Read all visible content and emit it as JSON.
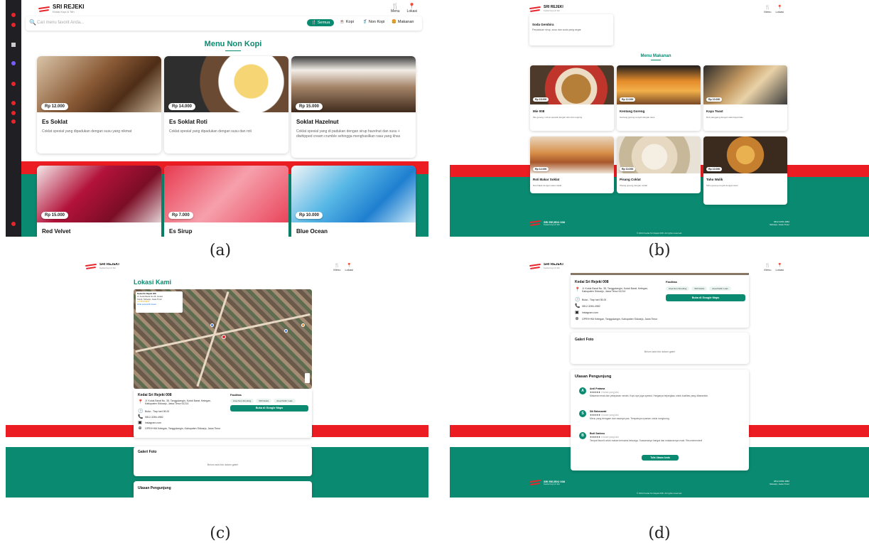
{
  "brand": {
    "name": "SRI REJEKI",
    "tagline": "Kedai Kopi & Teh"
  },
  "nav": {
    "menu_label": "Menu",
    "location_label": "Lokasi"
  },
  "captions": {
    "a": "(a)",
    "b": "(b)",
    "c": "(c)",
    "d": "(d)"
  },
  "panel_a": {
    "search_placeholder": "Cari menu favorit Anda...",
    "filters": [
      {
        "label": "Semua",
        "active": true
      },
      {
        "label": "Kopi",
        "active": false
      },
      {
        "label": "Non Kopi",
        "active": false
      },
      {
        "label": "Makanan",
        "active": false
      }
    ],
    "section_title": "Menu Non Kopi",
    "items": [
      {
        "name": "Es Soklat",
        "price": "Rp 12.000",
        "desc": "Coklat spesial yang dipadukan dengan susu yang nikmat"
      },
      {
        "name": "Es Soklat Roti",
        "price": "Rp 14.000",
        "desc": "Coklat spesial yang dipadukan dengan susu dan roti"
      },
      {
        "name": "Soklat Hazelnut",
        "price": "Rp 15.000",
        "desc": "Coklat spesial yang di padukan dengan sirup hazelnut dan susu + diwhipped cream crumble sehingga menghasilkan rasa yang khas"
      },
      {
        "name": "Red Velvet",
        "price": "Rp 15.000",
        "desc": ""
      },
      {
        "name": "Es Sirup",
        "price": "Rp 7.000",
        "desc": ""
      },
      {
        "name": "Blue Ocean",
        "price": "Rp 10.000",
        "desc": ""
      }
    ]
  },
  "panel_b": {
    "top_card": {
      "name": "Soda Gembira",
      "desc": "Perpaduan sirup, susu dan soda yang segar"
    },
    "section_title": "Menu Makanan",
    "items": [
      {
        "name": "Mie 008",
        "price": "Rp 15.000",
        "desc": "Mie goreng / rebus spesial dengan telur dan topping"
      },
      {
        "name": "Kentang Goreng",
        "price": "Rp 12.000",
        "desc": "Kentang goreng renyah dengan saus"
      },
      {
        "name": "Kaya Toast",
        "price": "Rp 10.000",
        "desc": "Roti panggang dengan selai kaya khas"
      },
      {
        "name": "Roti Bakar Soklat",
        "price": "Rp 12.000",
        "desc": "Roti bakar dengan selai coklat"
      },
      {
        "name": "Pisang Coklat",
        "price": "Rp 10.000",
        "desc": "Pisang goreng dengan coklat"
      },
      {
        "name": "Tahu Walik",
        "price": "Rp 10.000",
        "desc": "Tahu goreng renyah dengan isian"
      }
    ],
    "footer": {
      "title": "SRI REJEKI 008",
      "subtitle": "Kedai Kopi & Teh",
      "right_line1": "0812-3284-4982",
      "right_line2": "Sidoarjo, Jawa Timur",
      "copy": "© 2024 Kedai Sri Rejeki 008. All rights reserved."
    }
  },
  "panel_c": {
    "section_title": "Lokasi Kami",
    "map_popup": {
      "title": "Kedai Sri Rejeki 008",
      "line1": "Jl. Kutuk Barat No.35, Gelam",
      "line2": "Candi, Sidoarjo, Jawa Timur",
      "rating": "4.7 ★★★★★",
      "link": "Lihat peta lebih besar"
    },
    "info_title": "Kedai Sri Rejeki 008",
    "address": "Jl. Kutuk Barat No. 35, Tanggulangin, Kutuk Barat, Ketegan, Kabupaten Sidoarjo, Jawa Timur 61214",
    "hours": "Buka - Tiap hari 08.00",
    "phone": "0812-3284-4982",
    "instagram": "instagram.com",
    "plus_code": "GPR9+HM Ketegan, Tanggulangin, Kabupaten Sidoarjo, Jawa Timur",
    "facilities_title": "Fasilitas",
    "facilities": [
      "Area Non-Smoking",
      "Wifi Gratis",
      "Area Parkir Luas"
    ],
    "maps_button": "Buka di Google Maps",
    "gallery_title": "Galeri Foto",
    "gallery_empty": "Belum ada foto dalam galeri",
    "reviews_title": "Ulasan Pengunjung"
  },
  "panel_d": {
    "info_title": "Kedai Sri Rejeki 008",
    "address": "Jl. Kutuk Barat No. 35, Tanggulangin, Kutuk Barat, Ketegan, Kabupaten Sidoarjo, Jawa Timur 61214",
    "hours": "Buka - Tiap hari 08.00",
    "phone": "0812-3284-4982",
    "instagram": "instagram.com",
    "plus_code": "GPR9+HM Ketegan, Tanggulangin, Kabupaten Sidoarjo, Jawa Timur",
    "facilities_title": "Fasilitas",
    "facilities": [
      "Area Non-Smoking",
      "Wifi Gratis",
      "Area Parkir Luas"
    ],
    "maps_button": "Buka di Google Maps",
    "gallery_title": "Galeri Foto",
    "gallery_empty": "Belum ada foto dalam galeri",
    "reviews_title": "Ulasan Pengunjung",
    "reviews": [
      {
        "initial": "A",
        "name": "Andi Pratama",
        "stars": "★★★★★",
        "date": "2 bulan yang lalu",
        "text": "Makanan enak dan pelayanan ramah. Kopi-nya juga spesial. Harganya terjangkau untuk kualitas yang ditawarkan."
      },
      {
        "initial": "S",
        "name": "Siti Rahmawati",
        "stars": "★★★★★",
        "date": "3 bulan yang lalu",
        "text": "Menu yang beragam dan rasanya pas. Tempatnya nyaman untuk nongkrong."
      },
      {
        "initial": "B",
        "name": "Budi Santoso",
        "stars": "★★★★★",
        "date": "4 bulan yang lalu",
        "text": "Tempat favorit untuk makan bersama keluarga. Suasananya hangat dan makanannya enak. Recommended!"
      }
    ],
    "add_review_button": "Tulis Ulasan Anda",
    "footer": {
      "title": "SRI REJEKI 008",
      "subtitle": "Kedai Kopi & Teh",
      "right_line1": "0812-3284-4982",
      "right_line2": "Sidoarjo, Jawa Timur",
      "copy": "© 2024 Kedai Sri Rejeki 008. All rights reserved."
    }
  },
  "colors": {
    "teal": "#0a8a70",
    "red": "#ec1d22",
    "dark": "#1f1f24"
  }
}
